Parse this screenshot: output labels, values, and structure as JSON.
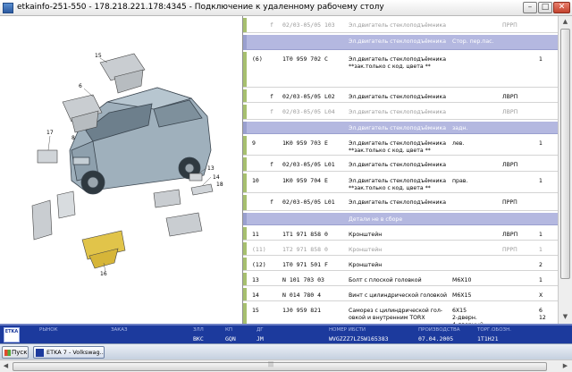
{
  "window": {
    "title": "etkainfo-251-550 - 178.218.221.178:4345 - Подключение к удаленному рабочему столу",
    "min_glyph": "–",
    "max_glyph": "□",
    "close_glyph": "✕"
  },
  "illustration": {
    "callouts": [
      "15",
      "6",
      "8",
      "17",
      "13",
      "14",
      "18",
      "16"
    ]
  },
  "parts_rows": [
    {
      "type": "grey",
      "pos": "",
      "ptype": "f",
      "num": "02/03-05/05 103",
      "desc": "Эл.двигатель стеклоподъёмника",
      "note": "",
      "qty": "ПРРП",
      "extra": ""
    },
    {
      "type": "head",
      "pos": "",
      "ptype": "",
      "num": "",
      "desc": "Эл.двигатель стеклоподъёмника",
      "note": "Стор. пер.пас.",
      "qty": "",
      "extra": ""
    },
    {
      "type": "row",
      "pos": "(6)",
      "ptype": "",
      "num": "1T0 959 702 C",
      "desc": "Эл.двигатель стеклоподъёмника",
      "desc2": "**зак.только с код. цвета **",
      "note": "",
      "qty": "",
      "extra": "1"
    },
    {
      "type": "row",
      "pos": "",
      "ptype": "f",
      "num": "02/03-05/05 L02",
      "desc": "Эл.двигатель стеклоподъёмника",
      "note": "",
      "qty": "ЛВРП",
      "extra": ""
    },
    {
      "type": "grey",
      "pos": "",
      "ptype": "f",
      "num": "02/03-05/05 L04",
      "desc": "Эл.двигатель стеклоподъёмника",
      "note": "",
      "qty": "ЛВРП",
      "extra": ""
    },
    {
      "type": "head",
      "pos": "",
      "ptype": "",
      "num": "",
      "desc": "Эл.двигатель стеклоподъёмника",
      "note": "задн.",
      "qty": "",
      "extra": ""
    },
    {
      "type": "row",
      "pos": "9",
      "ptype": "",
      "num": "1K0 959 703 E",
      "desc": "Эл.двигатель стеклоподъёмника",
      "desc2": "**зак.только с код. цвета **",
      "note": "лев.",
      "qty": "",
      "extra": "1"
    },
    {
      "type": "row",
      "pos": "",
      "ptype": "f",
      "num": "02/03-05/05 L01",
      "desc": "Эл.двигатель стеклоподъёмника",
      "note": "",
      "qty": "ЛВРП",
      "extra": ""
    },
    {
      "type": "row",
      "pos": "10",
      "ptype": "",
      "num": "1K0 959 704 E",
      "desc": "Эл.двигатель стеклоподъёмника",
      "desc2": "**зак.только с код. цвета **",
      "note": "прав.",
      "qty": "",
      "extra": "1"
    },
    {
      "type": "row",
      "pos": "",
      "ptype": "f",
      "num": "02/03-05/05 L01",
      "desc": "Эл.двигатель стеклоподъёмника",
      "note": "",
      "qty": "ПРРП",
      "extra": ""
    },
    {
      "type": "head",
      "pos": "",
      "ptype": "",
      "num": "",
      "desc": "Детали не в сборе",
      "note": "",
      "qty": "",
      "extra": ""
    },
    {
      "type": "row",
      "pos": "11",
      "ptype": "",
      "num": "1T1 971 858 0",
      "desc": "Кронштейн",
      "note": "",
      "qty": "ЛВРП",
      "extra": "1"
    },
    {
      "type": "grey",
      "pos": "(11)",
      "ptype": "",
      "num": "1T2 971 858 0",
      "desc": "Кронштейн",
      "note": "",
      "qty": "ПРРП",
      "extra": "1"
    },
    {
      "type": "row",
      "pos": "(12)",
      "ptype": "",
      "num": "1T0 971 501 F",
      "desc": "Кронштейн",
      "note": "",
      "qty": "",
      "extra": "2"
    },
    {
      "type": "row",
      "pos": "13",
      "ptype": "",
      "num": "N 101 703 03",
      "desc": "Болт с плоской головкой",
      "note": "M6X10",
      "qty": "",
      "extra": "1"
    },
    {
      "type": "row",
      "pos": "14",
      "ptype": "",
      "num": "N 014 780 4",
      "desc": "Винт с цилиндрической головкой",
      "note": "M6X15",
      "qty": "",
      "extra": "X"
    },
    {
      "type": "row",
      "pos": "15",
      "ptype": "",
      "num": "1J0 959 821",
      "desc": "Саморез с цилиндрической гол-",
      "desc2": "овкой и внутренним TORX",
      "note": "6X15",
      "note2": "2-дверн.",
      "note3": "4-дверный",
      "qty": "",
      "extra": "6",
      "extra2": "12"
    }
  ],
  "infobar": {
    "logo": "ETKA",
    "labels": [
      "РЫНОК",
      "ЗАКАЗ",
      "ЗЛЛ",
      "КП",
      "ДГ",
      "НОМЕР ИБСТИ",
      "ПРОИЗВОДСТВА",
      "ТОРГ.ОБОЗН."
    ],
    "values": [
      "",
      "",
      "BKC",
      "GQN",
      "JM",
      "WVGZZZ7LZ5W165383",
      "07.04.2005",
      "1T1H21"
    ]
  },
  "taskbar": {
    "start_label": "Пуск",
    "item_label": "ETKA 7 - Volkswag..."
  },
  "scroll": {
    "up": "▲",
    "down": "▼",
    "left": "◀",
    "right": "▶",
    "grip": "|||"
  },
  "colors": {
    "accent_bar": "#a7c06f",
    "header_row": "#b4b8e0",
    "footer": "#1c3a9d"
  }
}
